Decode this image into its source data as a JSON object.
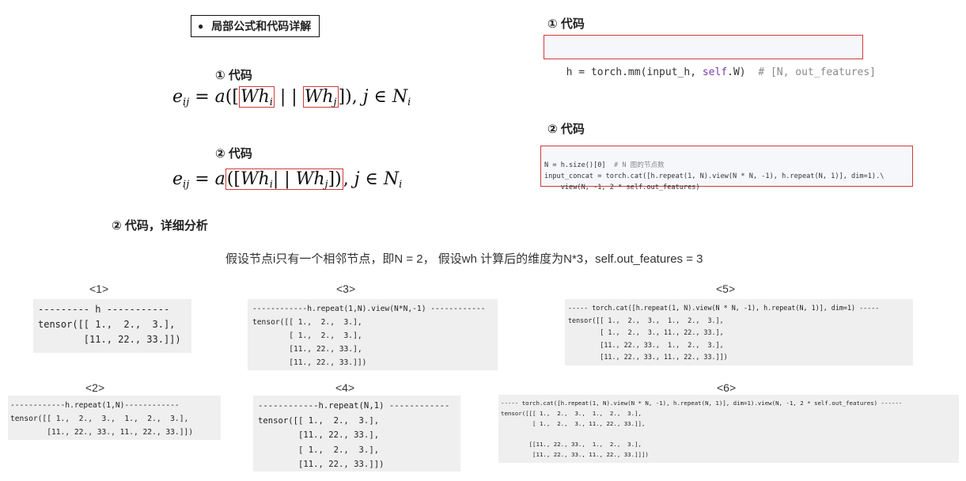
{
  "section_title": "局部公式和代码详解",
  "left": {
    "label1": "① 代码",
    "label2": "② 代码",
    "analysis_label": "② 代码，详细分析"
  },
  "right": {
    "label1": "① 代码",
    "code1": {
      "prefix": "h = torch.mm(input_h, ",
      "kw": "self",
      "suffix": ".W)  ",
      "comment": "# [N, out_features]"
    },
    "label2": "② 代码",
    "code2": {
      "l1_code": "N = h.size()[0]  ",
      "l1_comment": "# N 图的节点数",
      "l2": "input_concat = torch.cat([h.repeat(1, N).view(N * N, -1), h.repeat(N, 1)], dim=1).\\",
      "l3": "    view(N, -1, 2 * self.out_features)"
    }
  },
  "assumption": "假设节点i只有一个相邻节点，即N = 2，  假设wh 计算后的维度为N*3，self.out_features = 3",
  "blocks": [
    {
      "id": "b1",
      "title": "<1>",
      "lines": [
        "--------- h -----------",
        "tensor([[ 1.,  2.,  3.],",
        "        [11., 22., 33.]])"
      ]
    },
    {
      "id": "b2",
      "title": "<2>",
      "lines": [
        "------------h.repeat(1,N)------------",
        "tensor([[ 1.,  2.,  3.,  1.,  2.,  3.],",
        "        [11., 22., 33., 11., 22., 33.]])"
      ]
    },
    {
      "id": "b3",
      "title": "<3>",
      "lines": [
        "------------h.repeat(1,N).view(N*N,-1) ------------",
        "tensor([[ 1.,  2.,  3.],",
        "        [ 1.,  2.,  3.],",
        "        [11., 22., 33.],",
        "        [11., 22., 33.]])"
      ]
    },
    {
      "id": "b4",
      "title": "<4>",
      "lines": [
        "------------h.repeat(N,1) ------------",
        "tensor([[ 1.,  2.,  3.],",
        "        [11., 22., 33.],",
        "        [ 1.,  2.,  3.],",
        "        [11., 22., 33.]])"
      ]
    },
    {
      "id": "b5",
      "title": "<5>",
      "lines": [
        "----- torch.cat([h.repeat(1, N).view(N * N, -1), h.repeat(N, 1)], dim=1) -----",
        "tensor([[ 1.,  2.,  3.,  1.,  2.,  3.],",
        "        [ 1.,  2.,  3., 11., 22., 33.],",
        "        [11., 22., 33.,  1.,  2.,  3.],",
        "        [11., 22., 33., 11., 22., 33.]])"
      ]
    },
    {
      "id": "b6",
      "title": "<6>",
      "lines": [
        "----- torch.cat([h.repeat(1, N).view(N * N, -1), h.repeat(N, 1)], dim=1).view(N, -1, 2 * self.out_features) ------",
        "tensor([[[ 1.,  2.,  3.,  1.,  2.,  3.],",
        "         [ 1.,  2.,  3., 11., 22., 33.]],",
        "",
        "        [[11., 22., 33.,  1.,  2.,  3.],",
        "         [11., 22., 33., 11., 22., 33.]]])"
      ]
    }
  ]
}
